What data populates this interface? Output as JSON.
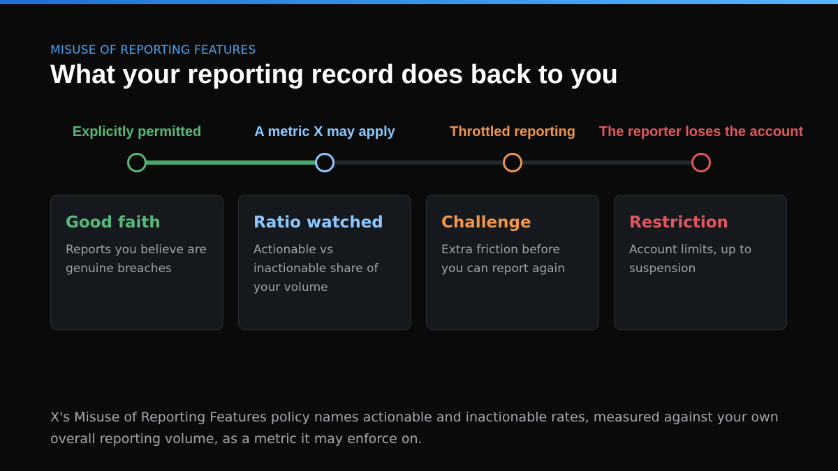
{
  "colors": {
    "accent": "#4aa3f0",
    "green": "#57b87a",
    "blue": "#8cc8ff",
    "orange": "#f0954c",
    "red": "#e0585e"
  },
  "header": {
    "eyebrow": "MISUSE OF REPORTING FEATURES",
    "title": "What your reporting record does back to you"
  },
  "timeline": {
    "progress_stage": 2,
    "stages": [
      {
        "label": "Explicitly permitted",
        "color": "#57b87a",
        "card_title": "Good faith",
        "card_body": "Reports you believe are genuine breaches"
      },
      {
        "label": "A metric X may apply",
        "color": "#8cc8ff",
        "card_title": "Ratio watched",
        "card_body": "Actionable vs inactionable share of your volume"
      },
      {
        "label": "Throttled reporting",
        "color": "#f0954c",
        "card_title": "Challenge",
        "card_body": "Extra friction before you can report again"
      },
      {
        "label": "The reporter loses the account",
        "color": "#e0585e",
        "card_title": "Restriction",
        "card_body": "Account limits, up to suspension"
      }
    ]
  },
  "footnote": "X's Misuse of Reporting Features policy names actionable and inactionable rates, measured against your own overall reporting volume, as a metric it may enforce on."
}
